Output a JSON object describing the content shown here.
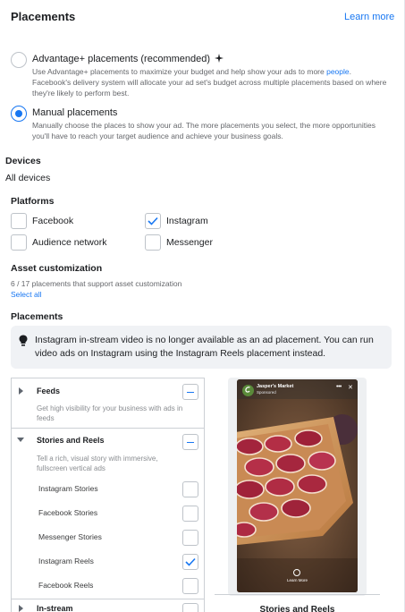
{
  "header": {
    "title": "Placements",
    "learn_more": "Learn more"
  },
  "placement_options": {
    "advantage": {
      "title": "Advantage+ placements (recommended)",
      "desc_before_link": "Use Advantage+ placements to maximize your budget and help show your ads to more ",
      "desc_link": "people",
      "desc_after_link": ". Facebook's delivery system will allocate your ad set's budget across multiple placements based on where they're likely to perform best.",
      "selected": false
    },
    "manual": {
      "title": "Manual placements",
      "desc": "Manually choose the places to show your ad. The more placements you select, the more opportunities you'll have to reach your target audience and achieve your business goals.",
      "selected": true
    }
  },
  "devices": {
    "label": "Devices",
    "value": "All devices"
  },
  "platforms": {
    "label": "Platforms",
    "items": [
      {
        "label": "Facebook",
        "checked": false
      },
      {
        "label": "Instagram",
        "checked": true
      },
      {
        "label": "Audience network",
        "checked": false
      },
      {
        "label": "Messenger",
        "checked": false
      }
    ]
  },
  "asset_customization": {
    "label": "Asset customization",
    "count_text": "6 / 17 placements that support asset customization",
    "select_all": "Select all"
  },
  "placements_section": {
    "label": "Placements",
    "info_text": "Instagram in-stream video is no longer available as an ad placement. You can run video ads on Instagram using the Instagram Reels placement instead.",
    "groups": [
      {
        "name": "Feeds",
        "desc": "Get high visibility for your business with ads in feeds",
        "expanded": false
      },
      {
        "name": "Stories and Reels",
        "desc": "Tell a rich, visual story with immersive, fullscreen vertical ads",
        "expanded": true
      },
      {
        "name": "In-stream",
        "expanded": false
      }
    ],
    "story_items": [
      {
        "label": "Instagram Stories",
        "checked": false
      },
      {
        "label": "Facebook Stories",
        "checked": false
      },
      {
        "label": "Messenger Stories",
        "checked": false
      },
      {
        "label": "Instagram Reels",
        "checked": true
      },
      {
        "label": "Facebook Reels",
        "checked": false
      }
    ]
  },
  "preview": {
    "brand_name": "Jasper's Market",
    "sponsored": "Sponsored",
    "cta": "Learn More",
    "caption": "Stories and Reels"
  },
  "colors": {
    "accent": "#1877f2",
    "border": "#ccd0d5",
    "info_bg": "#f0f2f5"
  }
}
